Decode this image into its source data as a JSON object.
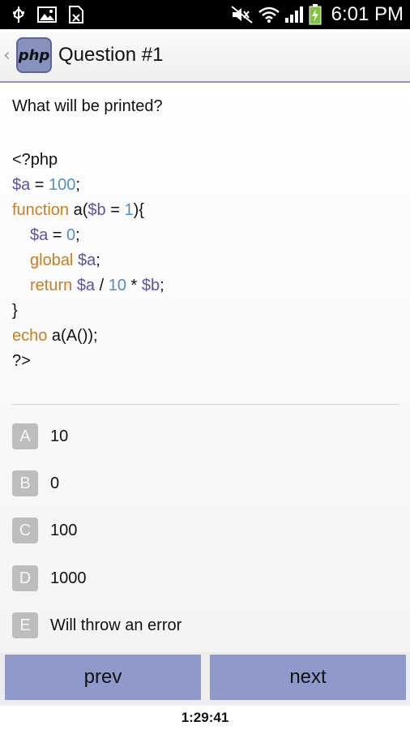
{
  "status_bar": {
    "time": "6:01 PM",
    "left_icons": [
      "usb-icon",
      "image-icon",
      "sim-icon"
    ],
    "right_icons": [
      "mute-icon",
      "wifi-icon",
      "signal-icon",
      "battery-charging-icon"
    ]
  },
  "action_bar": {
    "logo_text": "php",
    "title": "Question #1",
    "accent_color": "#8892bf"
  },
  "question": {
    "prompt": "What will be printed?",
    "code": {
      "line1": "<?php",
      "line2_var": "$a",
      "line2_eq": " = ",
      "line2_num": "100",
      "line2_end": ";",
      "line3_kw": "function",
      "line3_a": " a(",
      "line3_var": "$b",
      "line3_eq": " = ",
      "line3_num": "1",
      "line3_end": "){",
      "line4_var": "$a",
      "line4_eq": " = ",
      "line4_num": "0",
      "line4_end": ";",
      "line5_kw": "global",
      "line5_sp": " ",
      "line5_var": "$a",
      "line5_end": ";",
      "line6_kw": "return",
      "line6_sp": " ",
      "line6_var": "$a",
      "line6_div": " / ",
      "line6_num": "10",
      "line6_mul": " * ",
      "line6_var2": "$b",
      "line6_end": ";",
      "line7": "}",
      "line8_kw": "echo",
      "line8_rest": " a(A());",
      "line9": "?>"
    }
  },
  "options": [
    {
      "letter": "A",
      "text": "10"
    },
    {
      "letter": "B",
      "text": "0"
    },
    {
      "letter": "C",
      "text": "100"
    },
    {
      "letter": "D",
      "text": "1000"
    },
    {
      "letter": "E",
      "text": "Will throw an error"
    }
  ],
  "navigation": {
    "prev_label": "prev",
    "next_label": "next",
    "button_color": "#8f9acb"
  },
  "timer": "1:29:41"
}
